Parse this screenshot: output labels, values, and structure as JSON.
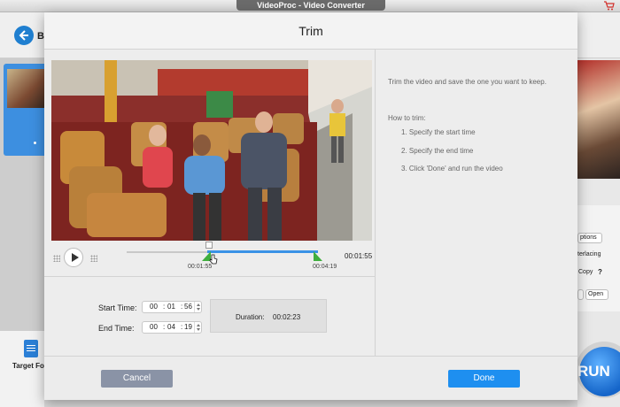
{
  "window": {
    "title": "VideoProc - Video Converter"
  },
  "background": {
    "back_label": "B",
    "target_format_label": "Target Fo",
    "right_panel": {
      "options_label": "ptions",
      "deinterlacing_label": "terlacing",
      "copy_label": "Copy",
      "help_label": "?",
      "open_label": "Open"
    },
    "run_label": "RUN"
  },
  "dialog": {
    "title": "Trim",
    "timeline": {
      "start_label": "00:01:55",
      "end_label": "00:04:19",
      "current_time": "00:01:55",
      "selection_start_fraction": 0.42,
      "selection_end_fraction": 1.0
    },
    "form": {
      "start_time_label": "Start Time:",
      "start_time": {
        "h": "00",
        "m": "01",
        "s": "56"
      },
      "end_time_label": "End Time:",
      "end_time": {
        "h": "00",
        "m": "04",
        "s": "19"
      },
      "duration_label": "Duration:",
      "duration_value": "00:02:23"
    },
    "info": {
      "intro": "Trim the video and save the one you want to keep.",
      "how_title": "How to trim:",
      "steps": [
        "1. Specify the start time",
        "2. Specify the end time",
        "3. Click 'Done' and run the video"
      ]
    },
    "buttons": {
      "cancel": "Cancel",
      "done": "Done"
    }
  },
  "colors": {
    "accent": "#1e8ff0",
    "handle": "#3fae3d",
    "cancel": "#8a93a6"
  }
}
